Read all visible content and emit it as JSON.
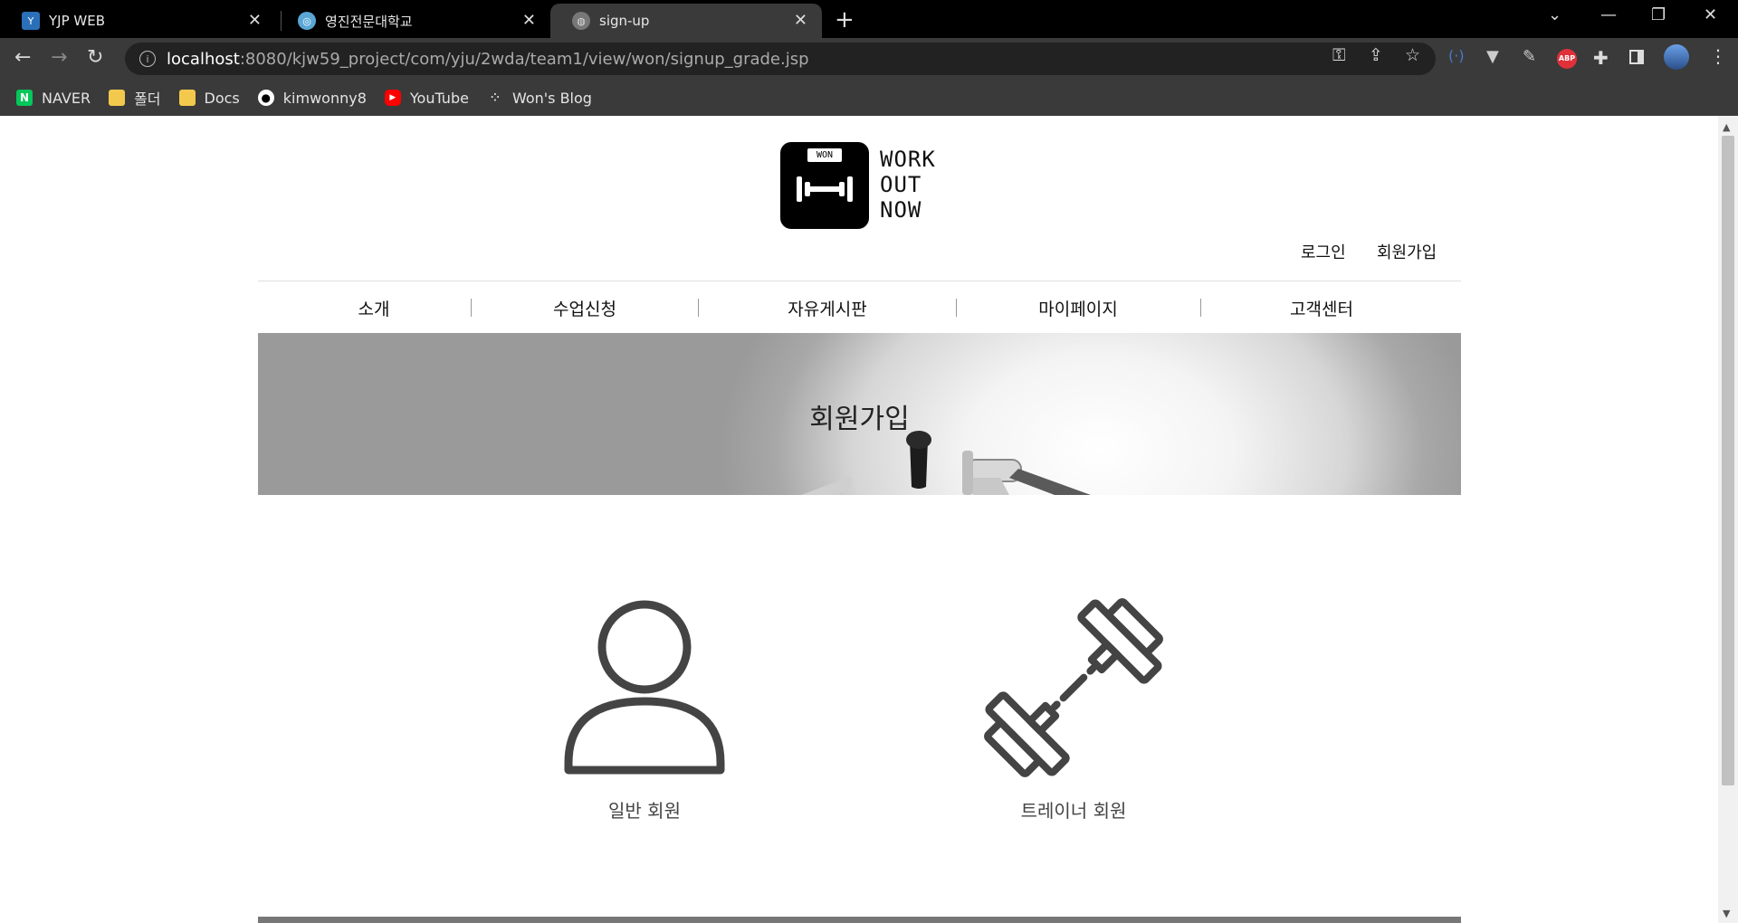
{
  "browser": {
    "tabs": [
      {
        "title": "YJP WEB"
      },
      {
        "title": "영진전문대학교"
      },
      {
        "title": "sign-up"
      }
    ],
    "url_host": "localhost",
    "url_path": ":8080/kjw59_project/com/yju/2wda/team1/view/won/signup_grade.jsp",
    "bookmarks": [
      {
        "label": "NAVER"
      },
      {
        "label": "폴더"
      },
      {
        "label": "Docs"
      },
      {
        "label": "kimwonny8"
      },
      {
        "label": "YouTube"
      },
      {
        "label": "Won's Blog"
      }
    ],
    "abp_label": "ABP"
  },
  "header": {
    "logo_badge": "WON",
    "logo_lines": [
      "WORK",
      "OUT",
      "NOW"
    ],
    "login_link": "로그인",
    "signup_link": "회원가입"
  },
  "menu": [
    {
      "label": "소개"
    },
    {
      "label": "수업신청"
    },
    {
      "label": "자유게시판"
    },
    {
      "label": "마이페이지"
    },
    {
      "label": "고객센터"
    }
  ],
  "hero": {
    "title": "회원가입"
  },
  "choices": [
    {
      "label": "일반 회원",
      "icon": "person-icon"
    },
    {
      "label": "트레이너 회원",
      "icon": "dumbbell-icon"
    }
  ]
}
